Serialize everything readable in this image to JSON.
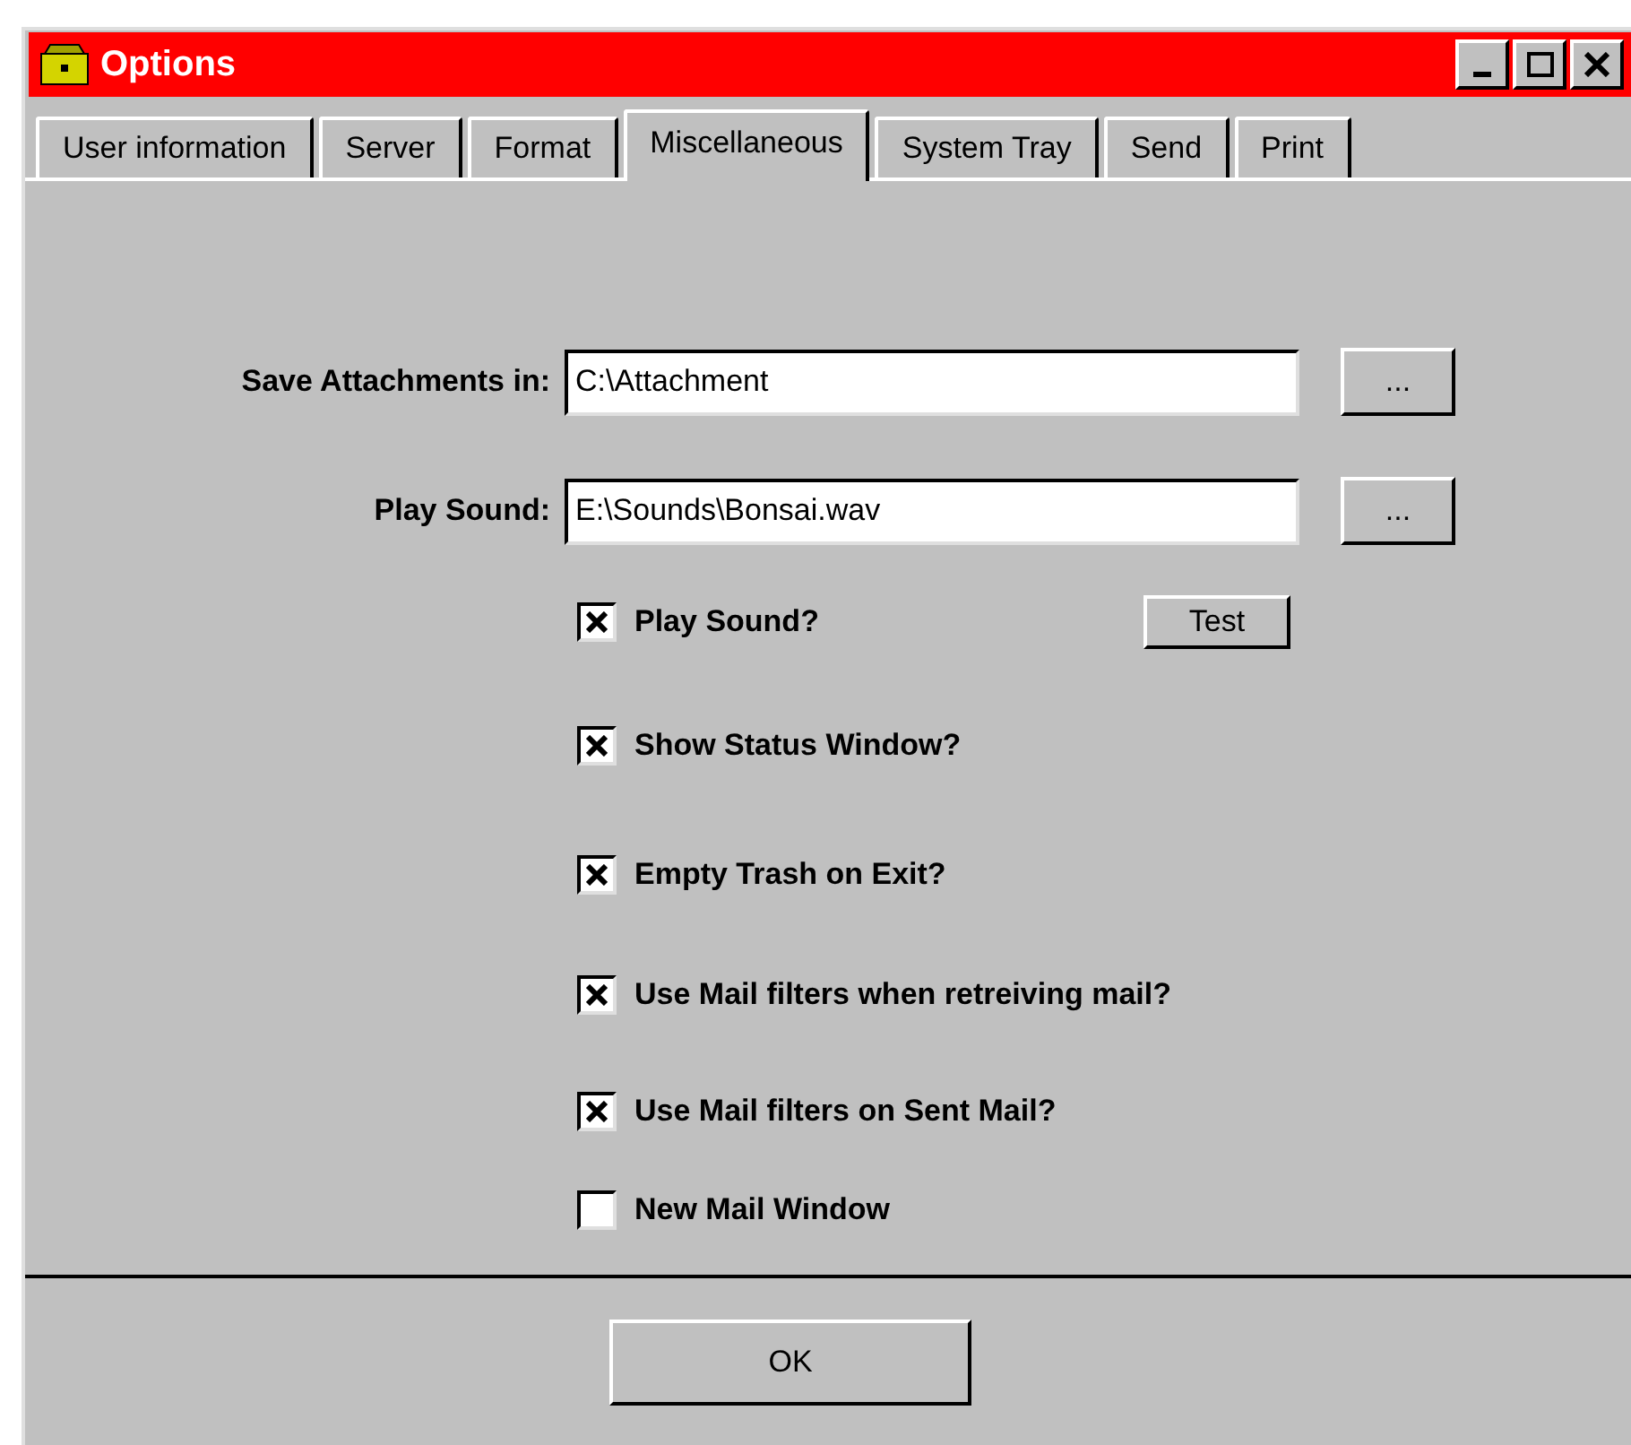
{
  "window": {
    "title": "Options"
  },
  "tabs": [
    {
      "label": "User information",
      "selected": false
    },
    {
      "label": "Server",
      "selected": false
    },
    {
      "label": "Format",
      "selected": false
    },
    {
      "label": "Miscellaneous",
      "selected": true
    },
    {
      "label": "System Tray",
      "selected": false
    },
    {
      "label": "Send",
      "selected": false
    },
    {
      "label": "Print",
      "selected": false
    }
  ],
  "paths": [
    {
      "label": "Save Attachments in:",
      "value": "C:\\Attachment",
      "browse": "..."
    },
    {
      "label": "Play Sound:",
      "value": "E:\\Sounds\\Bonsai.wav",
      "browse": "..."
    }
  ],
  "checkboxes": [
    {
      "label": "Play Sound?",
      "checked": true,
      "button": "Test"
    },
    {
      "label": "Show Status Window?",
      "checked": true
    },
    {
      "label": "Empty Trash on Exit?",
      "checked": true
    },
    {
      "label": "Use Mail filters when retreiving mail?",
      "checked": true
    },
    {
      "label": "Use Mail filters on Sent Mail?",
      "checked": true
    },
    {
      "label": "New Mail Window",
      "checked": false
    }
  ],
  "ok_button": "OK"
}
